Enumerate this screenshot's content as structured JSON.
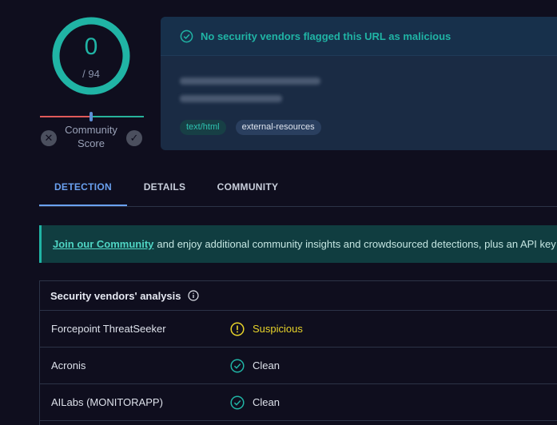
{
  "score": {
    "value": "0",
    "total": "/ 94"
  },
  "community": {
    "label": "Community Score"
  },
  "banner": {
    "text": "No security vendors flagged this URL as malicious"
  },
  "tags": [
    "text/html",
    "external-resources"
  ],
  "tabs": [
    "DETECTION",
    "DETAILS",
    "COMMUNITY"
  ],
  "join": {
    "link": "Join our Community",
    "text": "and enjoy additional community insights and crowdsourced detections, plus an API key"
  },
  "vendors": {
    "heading": "Security vendors' analysis",
    "rows": [
      {
        "name": "Forcepoint ThreatSeeker",
        "result": "Suspicious",
        "status": "suspicious"
      },
      {
        "name": "Acronis",
        "result": "Clean",
        "status": "clean"
      },
      {
        "name": "AILabs (MONITORAPP)",
        "result": "Clean",
        "status": "clean"
      }
    ]
  },
  "colors": {
    "accent": "#20b4a5",
    "active_tab": "#6aa1f0",
    "suspicious": "#e8d42a",
    "clean": "#20b4a5"
  }
}
